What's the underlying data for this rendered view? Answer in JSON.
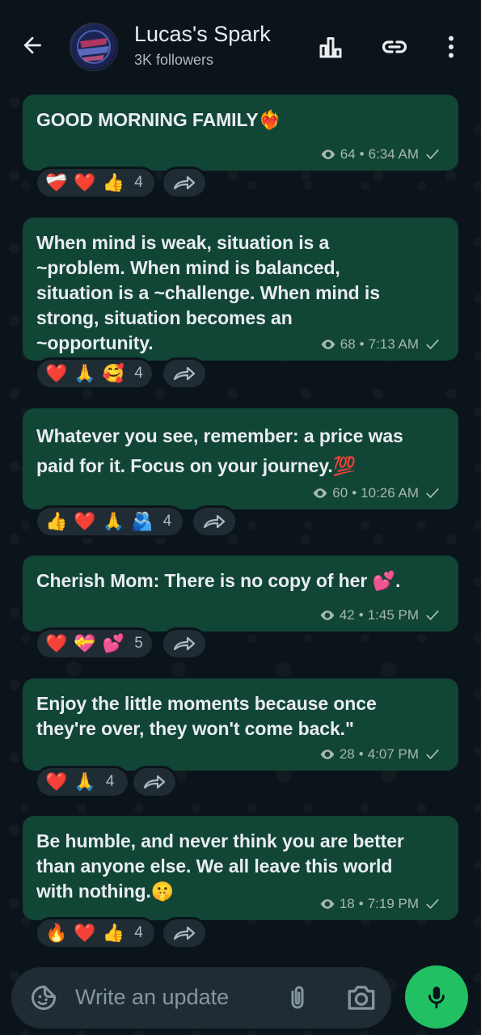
{
  "header": {
    "title": "Lucas's Spark",
    "subtitle": "3K followers"
  },
  "messages": [
    {
      "text": "GOOD MORNING FAMILY❤️‍🔥",
      "views": "64",
      "time": "6:34 AM",
      "reactions": [
        "❤️‍🩹",
        "❤️",
        "👍"
      ],
      "reaction_count": "4"
    },
    {
      "text": "When mind is weak, situation is a ~problem. When mind is balanced, situation is a ~challenge. When mind is strong, situation becomes an ~opportunity.",
      "views": "68",
      "time": "7:13 AM",
      "reactions": [
        "❤️",
        "🙏",
        "🥰"
      ],
      "reaction_count": "4"
    },
    {
      "text": "Whatever you see, remember: a price was paid for it. Focus on your journey.💯",
      "views": "60",
      "time": "10:26 AM",
      "reactions": [
        "👍",
        "❤️",
        "🙏",
        "🫂"
      ],
      "reaction_count": "4"
    },
    {
      "text": "Cherish Mom: There is no copy of her 💕.",
      "views": "42",
      "time": "1:45 PM",
      "reactions": [
        "❤️",
        "💝",
        "💕"
      ],
      "reaction_count": "5"
    },
    {
      "text": "Enjoy the little moments  because once they're over,  they won't come back.\"",
      "views": "28",
      "time": "4:07 PM",
      "reactions": [
        "❤️",
        "🙏"
      ],
      "reaction_count": "4"
    },
    {
      "text": "Be humble, and never think you are better than anyone else. We all leave this world with nothing.🤫",
      "views": "18",
      "time": "7:19 PM",
      "reactions": [
        "🔥",
        "❤️",
        "👍"
      ],
      "reaction_count": "4"
    }
  ],
  "composer": {
    "placeholder": "Write an update"
  },
  "colors": {
    "background": "#0b141a",
    "bubble": "#114536",
    "accent": "#21c063"
  }
}
